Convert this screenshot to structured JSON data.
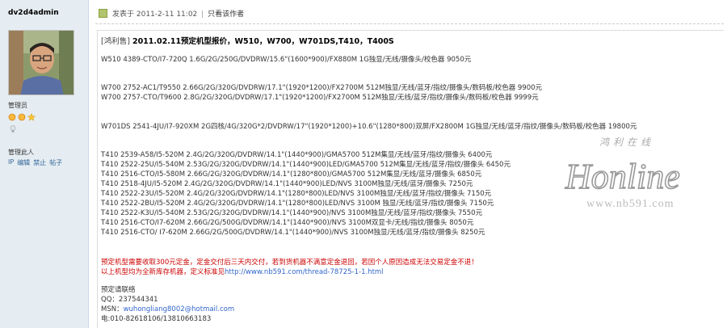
{
  "user": {
    "name": "dv2d4admin",
    "role": "管理员",
    "admin_title": "管理此人",
    "admin_links": [
      "IP",
      "编辑",
      "禁止",
      "帖子"
    ]
  },
  "post": {
    "meta_prefix": "发表于",
    "date": "2011-2-11 11:02",
    "separator": "|",
    "only_author": "只看该作者"
  },
  "content": {
    "title_bracket": "[鸿利售]",
    "title_text": "2011.02.11预定机型报价，W510，W700，W701DS,T410，T400S",
    "lines": [
      "W510 4389-CTO/I7-720Q 1.6G/2G/250G/DVDRW/15.6\"(1600*900)/FX880M 1G独显/无线/摄像头/校色器  9050元",
      "W700 2752-AC1/T9550 2.66G/2G/320G/DVDRW/17.1\"(1920*1200)/FX2700M 512M独显/无线/蓝牙/指纹/摄像头/数码板/校色器  9900元",
      "W700 2757-CTO/T9600 2.8G/2G/320G/DVDRW/17.1\"(1920*1200)/FX2700M 512M独显/无线/蓝牙/指纹/摄像头/数码板/校色器  9999元",
      "W701DS 2541-4JU/I7-920XM 2G四核/4G/320G*2/DVDRW/17\"(1920*1200)+10.6\"(1280*800)双屏/FX2800M 1G独显/无线/蓝牙/指纹/摄像头/数码板/校色器  19800元",
      "T410 2539-A58/I5-520M 2.4G/2G/320G/DVDRW/14.1\"(1440*900)/GMA5700 512M集显/无线/蓝牙/指纹/摄像头  6400元",
      "T410 2522-25U/I5-540M 2.53G/2G/320G/DVDRW/14.1\"(1440*900)LED/GMA5700 512M集显/无线/蓝牙/指纹/摄像头  6450元",
      "T410 2516-CTO/I5-580M 2.66G/2G/320G/DVDRW/14.1\"(1280*800)/GMA5700 512M集显/无线/蓝牙/摄像头  6850元",
      "T410 2518-4JU/I5-520M 2.4G/2G/320G/DVDRW/14.1\"(1440*900)LED/NVS 3100M独显/无线/蓝牙/摄像头 7250元",
      "T410 2522-23U/I5-520M 2.4G/2G/320G/DVDRW/14.1\"(1280*800)LED/NVS 3100M独显/无线/蓝牙/指纹/摄像头  7150元",
      "T410 2522-2BU/I5-520M 2.4G/2G/320G/DVDRW/14.1\"(1280*800)LED/NVS 3100M 独显/无线/蓝牙/指纹/摄像头  7150元",
      "T410 2522-K3U/I5-540M 2.53G/2G/320G/DVDRW/14.1\"(1440*900)/NVS 3100M独显/无线/蓝牙/指纹/摄像头  7550元",
      "T410 2516-CTO/I7-620M 2.66G/2G/500G/DVDRW/14.1\"(1440*900)/NVS 3100M双显卡/无线/指纹/摄像头  8050元",
      "T410 2516-CTO/ I7-620M 2.66G/2G/500G/DVDRW/14.1\"(1440*900)/NVS 3100M独显/无线/蓝牙/指纹/摄像头  8250元"
    ],
    "notice_1": "预定机型需要收取300元定金，定金交付后三天内交付，若到货机器不满意定金退回，若因个人原因造成无法交易定金不退！",
    "notice_2_prefix": "以上机型均为全新库存机器，定义标准见",
    "notice_2_link": "http://www.nb591.com/thread-78725-1-1.html",
    "contact_title": "预定请联络",
    "qq": "QQ：237544341",
    "msn_label": "MSN：",
    "msn_value": "wuhongliang8002@hotmail.com",
    "phone": "电:010-82618106/13810663183"
  },
  "watermark": {
    "cn": "鸿利在线",
    "latin": "Honline",
    "url": "www.nb591.com"
  },
  "colors": {
    "sidebar_bg": "#e5edf2",
    "notice_red": "#cc0000",
    "link_blue": "#3366cc"
  }
}
